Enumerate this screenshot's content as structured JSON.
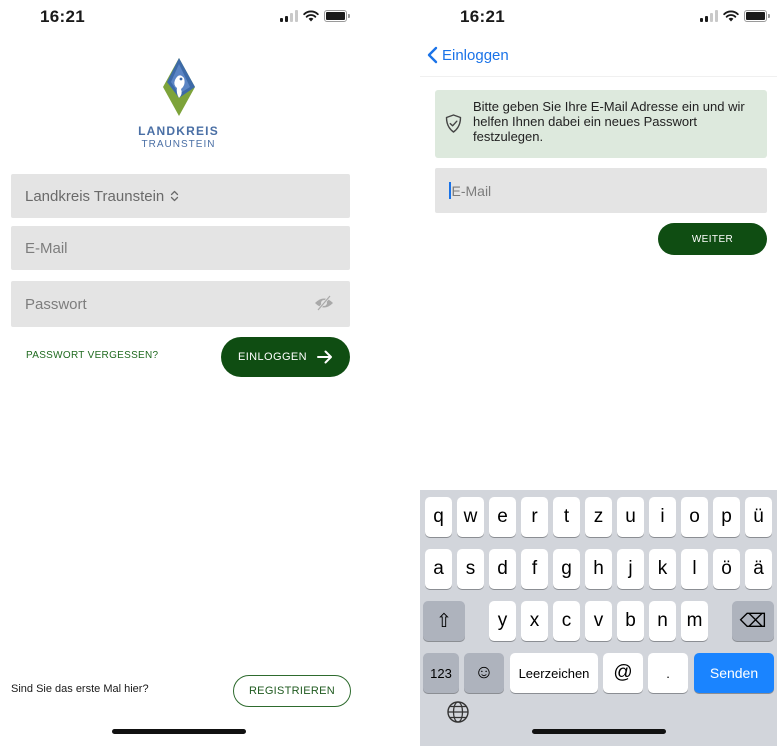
{
  "login_screen": {
    "status_time": "16:21",
    "brand": {
      "name": "LANDKREIS",
      "subtitle": "TRAUNSTEIN"
    },
    "region_select": {
      "value": "Landkreis Traunstein",
      "chevron": "⌃⌄"
    },
    "email": {
      "placeholder": "E-Mail"
    },
    "password": {
      "placeholder": "Passwort"
    },
    "forgot_password_label": "PASSWORT VERGESSEN?",
    "login_label": "EINLOGGEN",
    "first_time_text": "Sind Sie das erste Mal hier?",
    "register_label": "REGISTRIEREN"
  },
  "reset_screen": {
    "status_time": "16:21",
    "back_label": "Einloggen",
    "info_text": "Bitte geben Sie Ihre E-Mail Adresse ein und wir helfen Ihnen dabei ein neues Passwort festzulegen.",
    "email_placeholder": "E-Mail",
    "next_label": "WEITER"
  },
  "keyboard": {
    "row1": [
      "q",
      "w",
      "e",
      "r",
      "t",
      "z",
      "u",
      "i",
      "o",
      "p",
      "ü"
    ],
    "row2": [
      "a",
      "s",
      "d",
      "f",
      "g",
      "h",
      "j",
      "k",
      "l",
      "ö",
      "ä"
    ],
    "row3": [
      "y",
      "x",
      "c",
      "v",
      "b",
      "n",
      "m"
    ],
    "numbers_label": "123",
    "space_label": "Leerzeichen",
    "at_label": "@",
    "dot_label": ".",
    "send_label": "Senden",
    "shift_symbol": "⇧",
    "delete_symbol": "⌫",
    "emoji_symbol": "☺"
  },
  "colors": {
    "primary_green": "#0f4d12",
    "link_green": "#1f6a1f",
    "info_box": "#dde9dd",
    "field_bg": "#e4e4e4",
    "ios_blue": "#1a73e8",
    "brand_blue": "#4a6fa5"
  },
  "icons": {
    "logo": "landkreis-traunstein-logo",
    "eye": "eye-slash-icon",
    "shield": "shield-check-icon",
    "globe": "globe-icon",
    "back": "chevron-left-icon"
  }
}
